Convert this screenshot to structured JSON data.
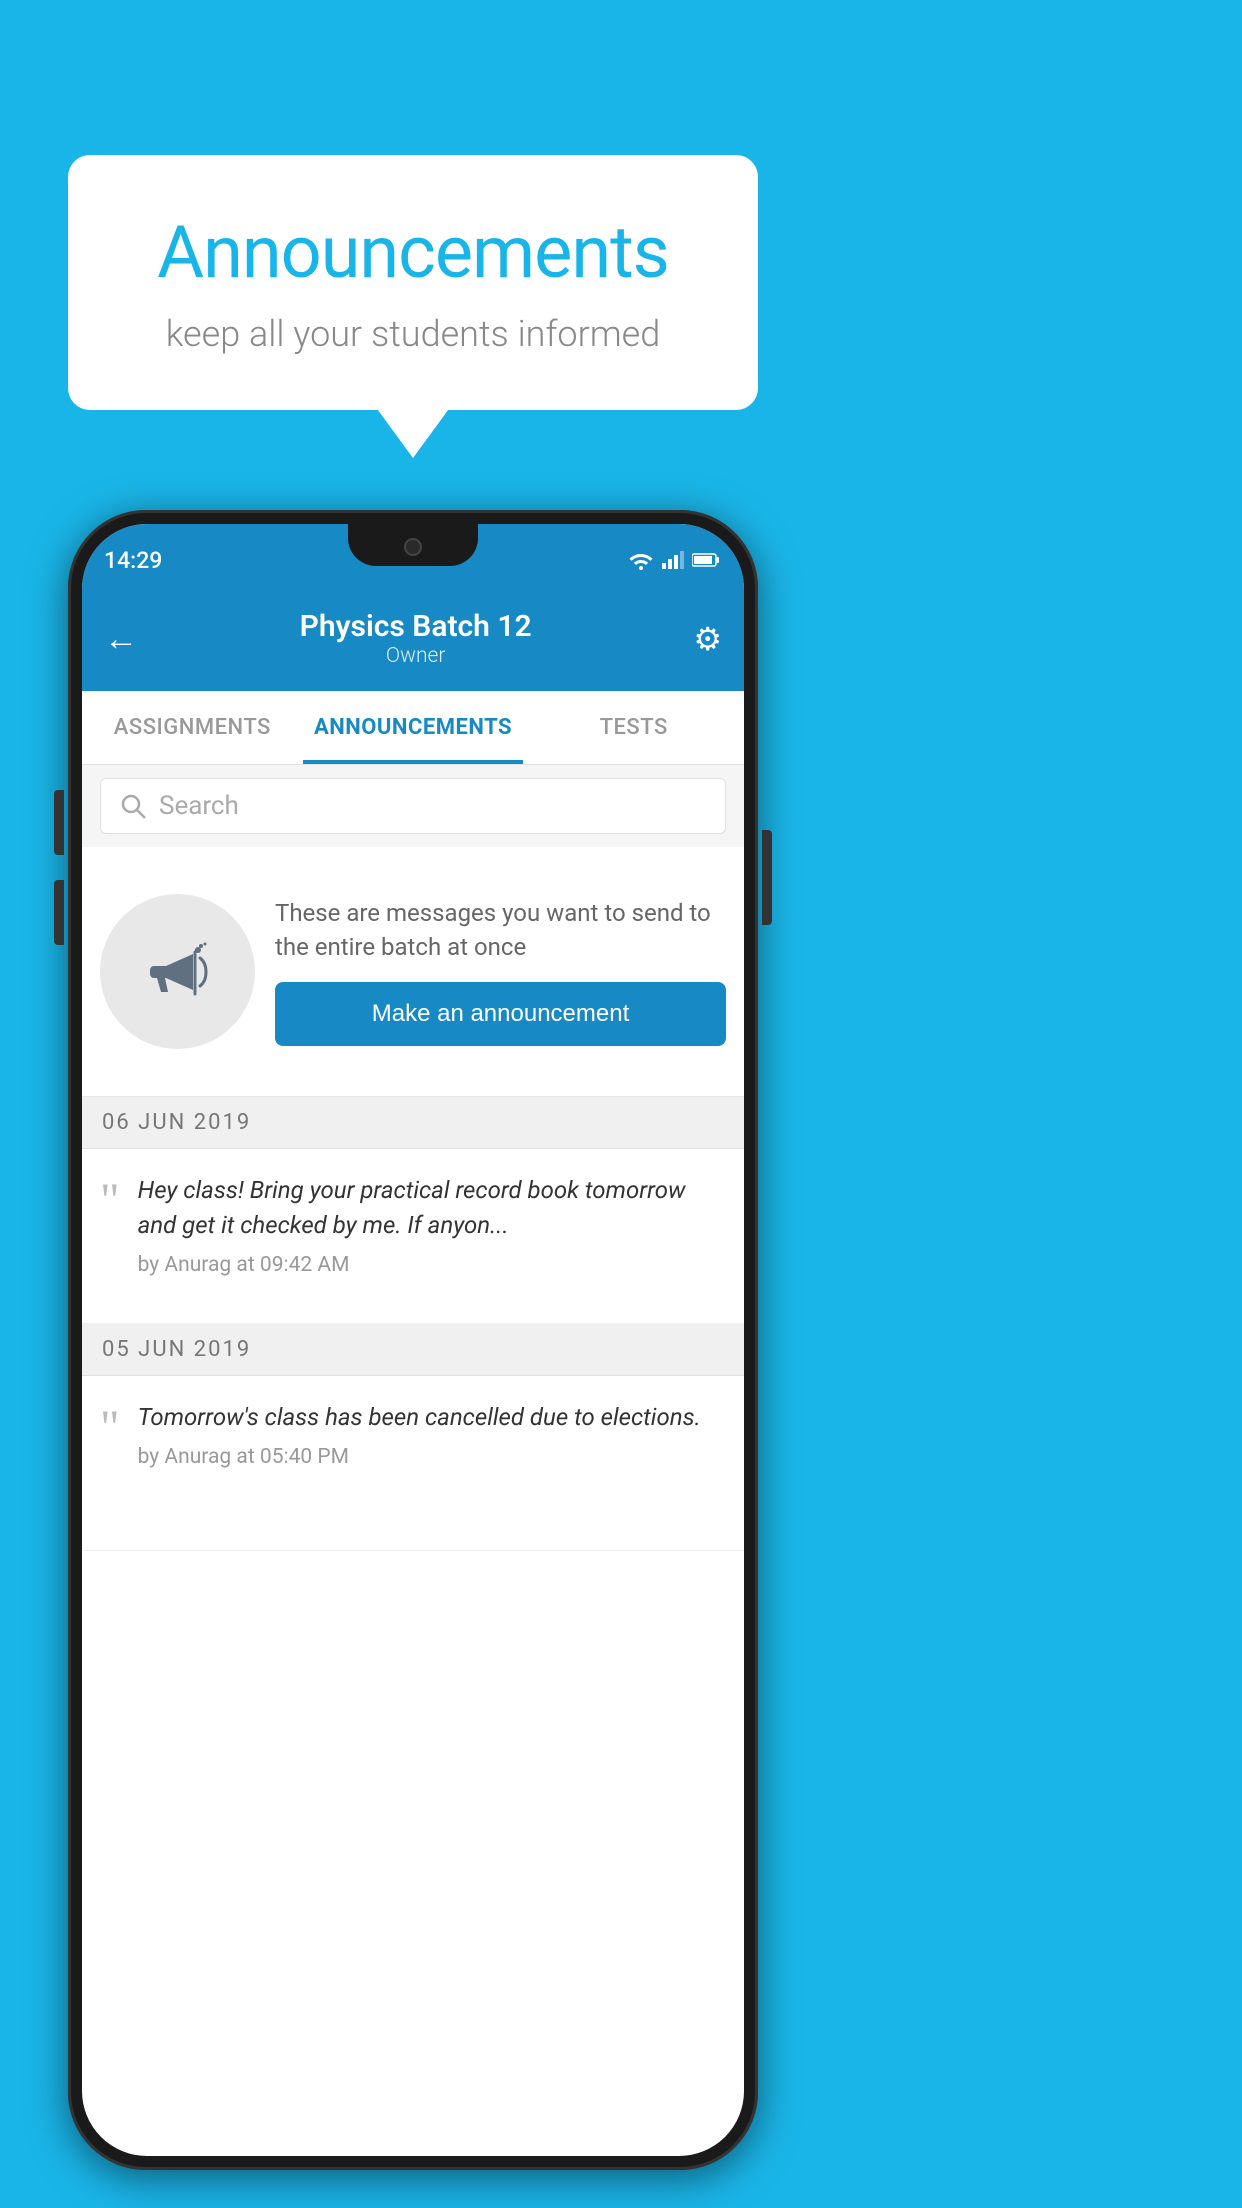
{
  "page": {
    "bg_color": "#1ab5e8"
  },
  "speech_bubble": {
    "title": "Announcements",
    "subtitle": "keep all your students informed"
  },
  "status_bar": {
    "time": "14:29",
    "wifi_symbol": "▼",
    "signal_symbol": "▲",
    "battery_symbol": "▐"
  },
  "header": {
    "back_icon": "←",
    "title": "Physics Batch 12",
    "subtitle": "Owner",
    "gear_icon": "⚙"
  },
  "tabs": [
    {
      "label": "ASSIGNMENTS",
      "active": false
    },
    {
      "label": "ANNOUNCEMENTS",
      "active": true
    },
    {
      "label": "TESTS",
      "active": false
    }
  ],
  "search": {
    "placeholder": "Search",
    "icon": "🔍"
  },
  "promo": {
    "description_text": "These are messages you want to send to the entire batch at once",
    "button_label": "Make an announcement"
  },
  "date_separators": [
    {
      "date": "06  JUN  2019"
    },
    {
      "date": "05  JUN  2019"
    }
  ],
  "announcements": [
    {
      "message": "Hey class! Bring your practical record book tomorrow and get it checked by me. If anyon...",
      "author": "by Anurag at 09:42 AM"
    },
    {
      "message": "Tomorrow's class has been cancelled due to elections.",
      "author": "by Anurag at 05:40 PM"
    }
  ]
}
